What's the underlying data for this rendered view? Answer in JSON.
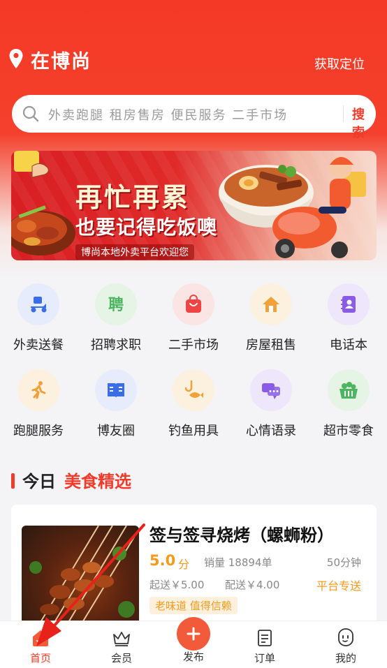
{
  "header": {
    "location": "在博尚",
    "get_location": "获取定位"
  },
  "search": {
    "placeholder": "外卖跑腿 租房售房 便民服务 二手市场",
    "button": "搜索"
  },
  "banner": {
    "title_line1": "再忙再累",
    "title_line2": "也要记得吃饭噢",
    "subtitle": "博尚本地外卖平台欢迎您"
  },
  "categories": [
    {
      "label": "外卖送餐",
      "icon": "delivery-scooter-icon",
      "color": "#3a6ee8",
      "bg": "#e6ecfb"
    },
    {
      "label": "招聘求职",
      "icon": "recruit-icon",
      "color": "#4cb560",
      "bg": "#e6f4e6"
    },
    {
      "label": "二手市场",
      "icon": "shopping-bag-icon",
      "color": "#ee4444",
      "bg": "#fbe4e4"
    },
    {
      "label": "房屋租售",
      "icon": "house-icon",
      "color": "#f1a13a",
      "bg": "#fcf0df"
    },
    {
      "label": "电话本",
      "icon": "contacts-icon",
      "color": "#8a5ce6",
      "bg": "#eee6fb"
    },
    {
      "label": "跑腿服务",
      "icon": "runner-icon",
      "color": "#f1a13a",
      "bg": "#fcf0df"
    },
    {
      "label": "博友圈",
      "icon": "book-icon",
      "color": "#3a6ee8",
      "bg": "#e6ecfb"
    },
    {
      "label": "钓鱼用具",
      "icon": "fish-hook-icon",
      "color": "#f1a13a",
      "bg": "#fcf0df"
    },
    {
      "label": "心情语录",
      "icon": "chat-bubble-icon",
      "color": "#8a5ce6",
      "bg": "#eee6fb"
    },
    {
      "label": "超市零食",
      "icon": "basket-icon",
      "color": "#4cb560",
      "bg": "#e6f4e6"
    }
  ],
  "section": {
    "title_prefix": "今日",
    "title_highlight": "美食精选"
  },
  "restaurant": {
    "name": "签与签寻烧烤（螺蛳粉）",
    "score": "5.0",
    "score_unit": "分",
    "sales": "销量 18894单",
    "time": "50分钟",
    "min_order": "起送￥5.00",
    "delivery_fee": "配送￥4.00",
    "delivery_type": "平台专送",
    "tag": "老味道 值得信赖"
  },
  "tabbar": {
    "home": "首页",
    "member": "会员",
    "publish": "发布",
    "orders": "订单",
    "mine": "我的"
  },
  "colors": {
    "brand_red": "#f03a2a",
    "accent_orange": "#f39a1e"
  }
}
